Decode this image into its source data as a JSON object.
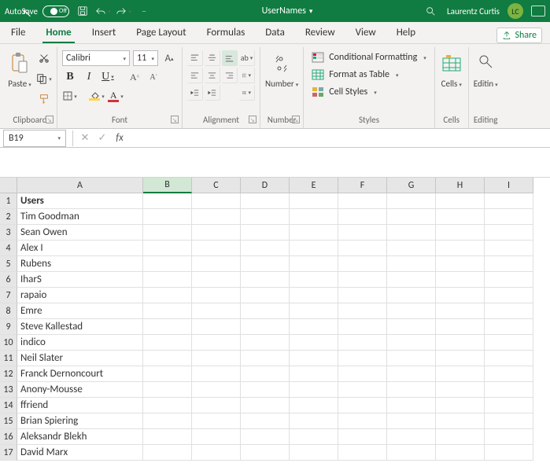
{
  "titlebar": {
    "autosave_label": "AutoSave",
    "autosave_state": "Off",
    "document_name": "UserNames",
    "user_name": "Laurentz Curtis",
    "user_initials": "LC"
  },
  "tabs": {
    "file": "File",
    "home": "Home",
    "insert": "Insert",
    "page_layout": "Page Layout",
    "formulas": "Formulas",
    "data": "Data",
    "review": "Review",
    "view": "View",
    "help": "Help",
    "share": "Share"
  },
  "ribbon": {
    "clipboard": {
      "label": "Clipboard",
      "paste": "Paste"
    },
    "font": {
      "label": "Font",
      "name": "Calibri",
      "size": "11",
      "bold": "B",
      "italic": "I",
      "underline": "U"
    },
    "alignment": {
      "label": "Alignment"
    },
    "number": {
      "label": "Number",
      "btn": "Number"
    },
    "styles": {
      "label": "Styles",
      "conditional": "Conditional Formatting",
      "table": "Format as Table",
      "cellstyles": "Cell Styles"
    },
    "cells": {
      "label": "Cells",
      "btn": "Cells"
    },
    "editing": {
      "label": "Editing",
      "btn": "Editin"
    }
  },
  "formula_bar": {
    "namebox": "B19",
    "cancel": "✕",
    "enter": "✓",
    "fx": "fx",
    "value": ""
  },
  "columns": [
    "A",
    "B",
    "C",
    "D",
    "E",
    "F",
    "G",
    "H",
    "I"
  ],
  "active_col_index": 1,
  "rows": [
    {
      "n": 1,
      "A": "Users",
      "bold": true
    },
    {
      "n": 2,
      "A": "Tim Goodman"
    },
    {
      "n": 3,
      "A": "Sean Owen"
    },
    {
      "n": 4,
      "A": "Alex I"
    },
    {
      "n": 5,
      "A": "Rubens"
    },
    {
      "n": 6,
      "A": "IharS"
    },
    {
      "n": 7,
      "A": "rapaio"
    },
    {
      "n": 8,
      "A": "Emre"
    },
    {
      "n": 9,
      "A": "Steve Kallestad"
    },
    {
      "n": 10,
      "A": "indico"
    },
    {
      "n": 11,
      "A": "Neil Slater"
    },
    {
      "n": 12,
      "A": "Franck Dernoncourt"
    },
    {
      "n": 13,
      "A": "Anony-Mousse"
    },
    {
      "n": 14,
      "A": "ffriend"
    },
    {
      "n": 15,
      "A": "Brian Spiering"
    },
    {
      "n": 16,
      "A": "Aleksandr Blekh"
    },
    {
      "n": 17,
      "A": "David Marx"
    }
  ]
}
